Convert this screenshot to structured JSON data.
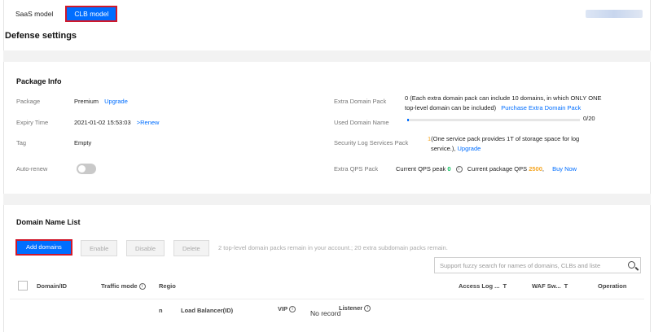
{
  "tabs": [
    {
      "label": "SaaS model",
      "active": false
    },
    {
      "label": "CLB model",
      "active": true
    }
  ],
  "page_title": "Defense settings",
  "package_info": {
    "title": "Package Info",
    "package_label": "Package",
    "package_value": "Premium",
    "upgrade_link": "Upgrade",
    "expiry_label": "Expiry Time",
    "expiry_value": "2021-01-02 15:53:03",
    "renew_link": ">Renew",
    "tag_label": "Tag",
    "tag_value": "Empty",
    "auto_renew_label": "Auto-renew",
    "auto_renew_on": false,
    "extra_domain_label": "Extra Domain Pack",
    "extra_domain_text_1": "0  (Each extra domain pack can include 10 domains, in which ONLY ONE",
    "extra_domain_text_2": "top-level domain can be included)",
    "purchase_link": "Purchase Extra Domain Pack",
    "used_domain_label": "Used Domain Name",
    "used_domain_value": "0/20",
    "used_domain_fraction": 0.0,
    "security_log_label": "Security Log Services Pack",
    "security_log_count": "1",
    "security_log_text_1": "(One service pack provides 1T of storage space for log",
    "security_log_text_2": "service.),",
    "security_log_upgrade": "Upgrade",
    "qps_label": "Extra QPS Pack",
    "qps_peak_text": "Current QPS peak",
    "qps_peak_value": "0",
    "qps_package_text": "Current package QPS",
    "qps_package_value": "2500",
    "buy_now_link": "Buy Now",
    "accent_color": "#006eff",
    "qps_value_color": "#f5a623",
    "count_color": "#0abf5b"
  },
  "domain_list": {
    "title": "Domain Name List",
    "add_button": "Add domains",
    "enable_button": "Enable",
    "disable_button": "Disable",
    "delete_button": "Delete",
    "remain_text": "2 top-level domain packs remain in your account.;  20 extra subdomain packs remain.",
    "search_placeholder": "Support fuzzy search for names of domains, CLBs and liste",
    "columns": {
      "domain": "Domain/ID",
      "traffic_mode": "Traffic mode",
      "region_top": "Regio",
      "region_bottom": "n",
      "load_balancer": "Load Balancer(ID)",
      "vip": "VIP",
      "listener": "Listener",
      "access_log": "Access Log ...",
      "waf_switch": "WAF Sw...",
      "operation": "Operation"
    },
    "empty_text": "No record"
  }
}
